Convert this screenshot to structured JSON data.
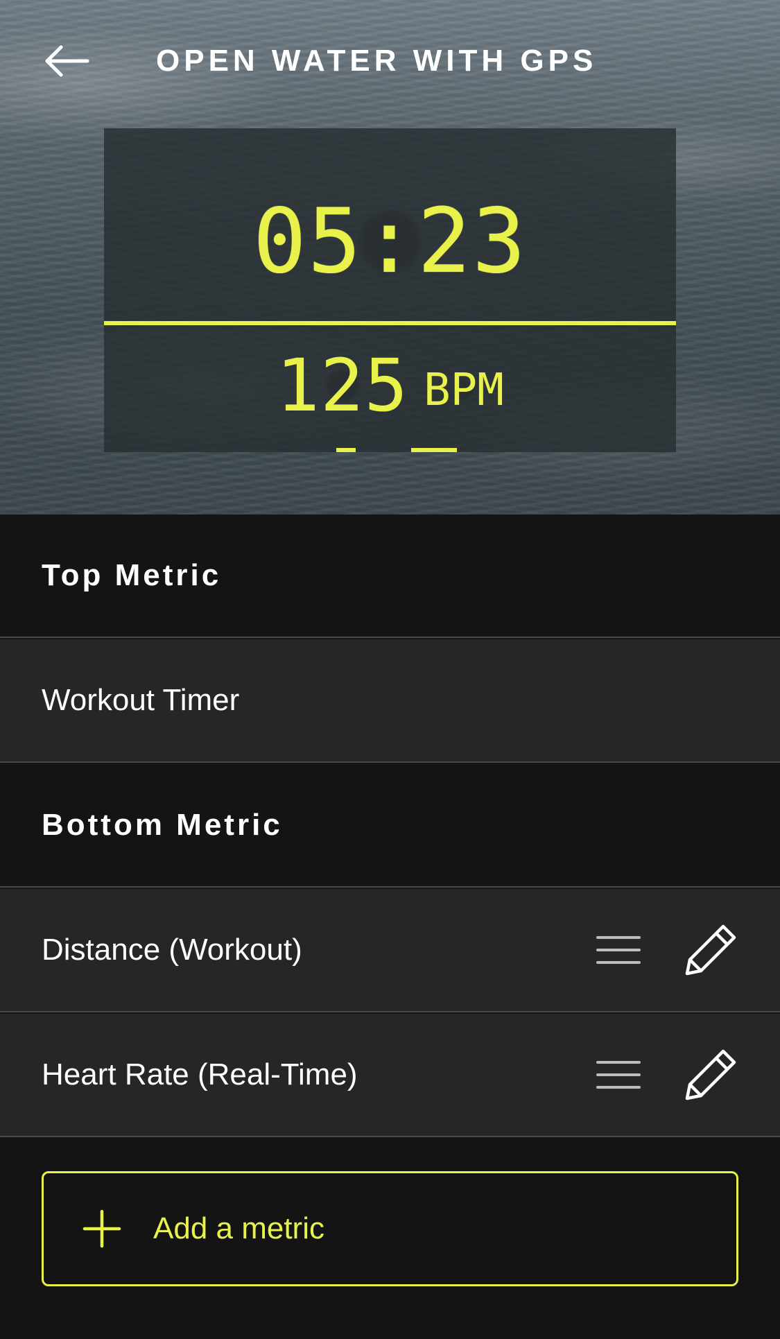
{
  "header": {
    "title": "OPEN WATER WITH GPS",
    "back_icon": "arrow-left-icon"
  },
  "preview": {
    "top_value": "05:23",
    "bottom_value": "125",
    "bottom_unit": "BPM",
    "accent_color": "#e9f24a",
    "page_count": 2,
    "active_page": 2
  },
  "sections": {
    "top_metric_title": "Top Metric",
    "bottom_metric_title": "Bottom Metric"
  },
  "top_metric": {
    "label": "Workout Timer"
  },
  "bottom_metrics": [
    {
      "label": "Distance (Workout)",
      "drag_icon": "drag-handle-icon",
      "edit_icon": "pencil-icon"
    },
    {
      "label": "Heart Rate (Real-Time)",
      "drag_icon": "drag-handle-icon",
      "edit_icon": "pencil-icon"
    }
  ],
  "add_metric": {
    "label": "Add a metric",
    "icon": "plus-icon"
  }
}
